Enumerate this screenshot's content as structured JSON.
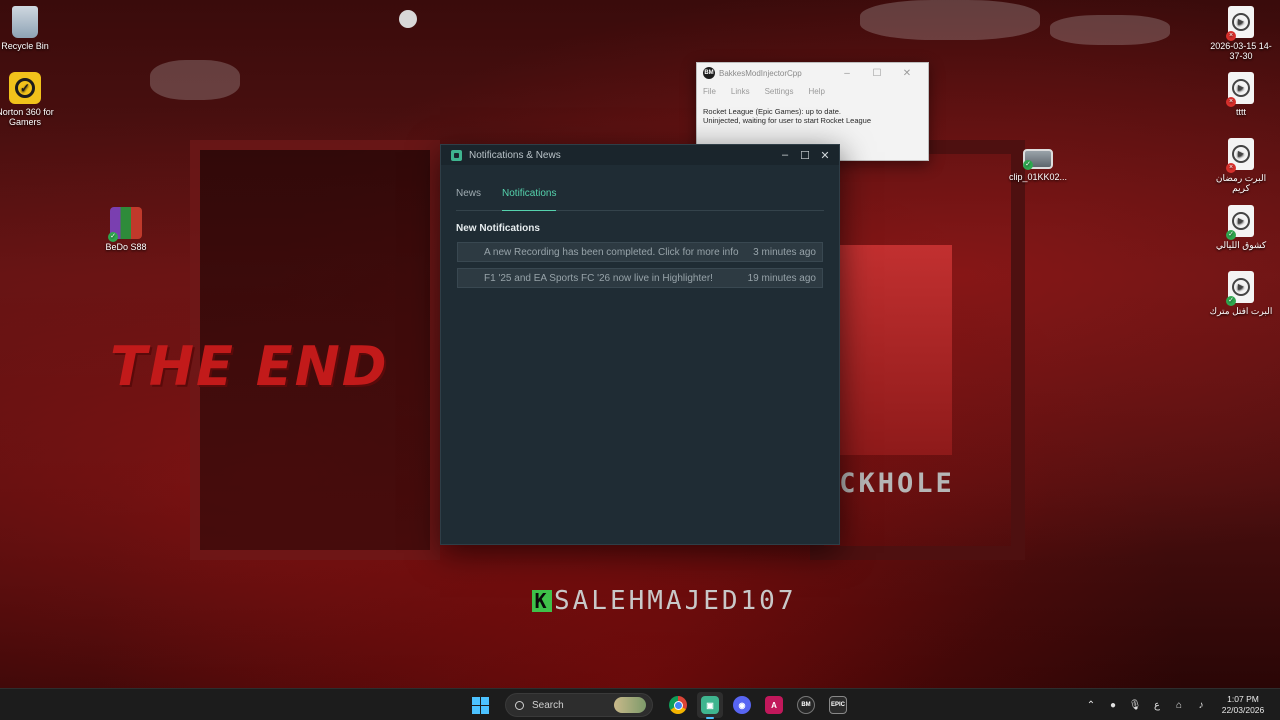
{
  "wallpaper": {
    "big_text": "THE END",
    "side_text": "ACKHOLE",
    "brand_letter": "K",
    "brand_text": "SALEHMAJED107"
  },
  "desktop_icons": {
    "recycle_bin": "Recycle Bin",
    "norton": "Norton 360 for Gamers",
    "bedo": "BeDo S88",
    "video1": "2026-03-15 14-37-30",
    "video2": "tttt",
    "video3": "البرت رمضان كريم",
    "video4": "كشوق الليالي",
    "video5": "البرت افتل مترك",
    "clip": "clip_01KK02..."
  },
  "bakkesmod": {
    "logo": "BM",
    "title": "BakkesModInjectorCpp",
    "menu": [
      "File",
      "Links",
      "Settings",
      "Help"
    ],
    "status_line1": "Rocket League (Epic Games): up to date.",
    "status_line2": "Uninjected, waiting for user to start Rocket League"
  },
  "notifications_window": {
    "title": "Notifications & News",
    "tabs": [
      {
        "label": "News",
        "active": false
      },
      {
        "label": "Notifications",
        "active": true
      }
    ],
    "heading": "New Notifications",
    "items": [
      {
        "message": "A new Recording has been completed. Click for more info",
        "time": "3 minutes ago"
      },
      {
        "message": "F1 '25 and EA Sports FC '26 now live in Highlighter!",
        "time": "19 minutes ago"
      }
    ]
  },
  "taskbar": {
    "search_label": "Search",
    "epic_label": "EPIC",
    "bm_label": "B\nM",
    "tray_lang": "ع",
    "time": "1:07 PM",
    "date": "22/03/2026"
  },
  "colors": {
    "accent": "#55d3ad",
    "window_bg": "#1f2c34",
    "row_bg": "#2d3a42"
  }
}
